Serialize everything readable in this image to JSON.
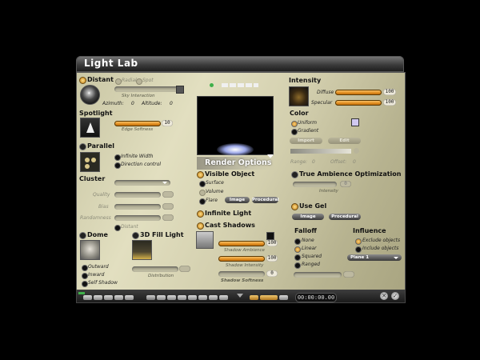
{
  "window": {
    "title": "Light Lab"
  },
  "left": {
    "distant": {
      "label": "Distant",
      "radial": "Radial",
      "spot": "Spot",
      "sky": "Sky Interaction",
      "azimuth_label": "Azimuth:",
      "azimuth_value": "0",
      "altitude_label": "Altitude:",
      "altitude_value": "0"
    },
    "spotlight": {
      "label": "Spotlight",
      "edge_label": "Edge Softness",
      "edge_value": "10"
    },
    "parallel": {
      "label": "Parallel",
      "infinite_width": "Infinite Width",
      "direction_control": "Direction control"
    },
    "cluster": {
      "label": "Cluster",
      "quality": "Quality",
      "bias": "Bias",
      "randomness": "Randomness",
      "distant": "Distant"
    },
    "dome": {
      "label": "Dome",
      "outward": "Outward",
      "inward": "Inward",
      "self_shadow": "Self Shadow"
    },
    "fill3d": {
      "label": "3D Fill Light",
      "distribution": "Distribution"
    }
  },
  "center": {
    "render_options": "Render Options",
    "visible_object": "Visible Object",
    "surface": "Surface",
    "volume": "Volume",
    "flare": "Flare",
    "image_btn": "Image",
    "procedural_btn": "Procedural",
    "infinite_light": "Infinite Light",
    "cast_shadows": "Cast Shadows",
    "shadow_ambience": "Shadow Ambience",
    "shadow_ambience_value": "100",
    "shadow_intensity": "Shadow Intensity",
    "shadow_intensity_value": "100",
    "shadow_softness": "Shadow Softness",
    "shadow_softness_value": "0"
  },
  "right": {
    "intensity": "Intensity",
    "diffuse": "Diffuse",
    "diffuse_value": "100",
    "specular": "Specular",
    "specular_value": "100",
    "color": "Color",
    "uniform": "Uniform",
    "gradient": "Gradient",
    "import_btn": "Import",
    "edit_btn": "Edit",
    "range_label": "Range:",
    "range_value": "0",
    "offset_label": "Offset:",
    "offset_value": "0",
    "true_ambience": "True Ambience Optimization",
    "ambience_intensity": "Intensity",
    "ambience_value": "0",
    "use_gel": "Use Gel",
    "gel_image_btn": "Image",
    "gel_procedural_btn": "Procedural",
    "falloff": "Falloff",
    "none": "None",
    "linear": "Linear",
    "squared": "Squared",
    "ranged": "Ranged",
    "influence": "Influence",
    "exclude": "Exclude objects",
    "include": "Include objects",
    "plane_select": "Plane 1"
  },
  "bottom": {
    "time": "00:00:00.00"
  },
  "colors": {
    "accent_orange": "#e08a1c",
    "panel": "#d3cfae"
  }
}
